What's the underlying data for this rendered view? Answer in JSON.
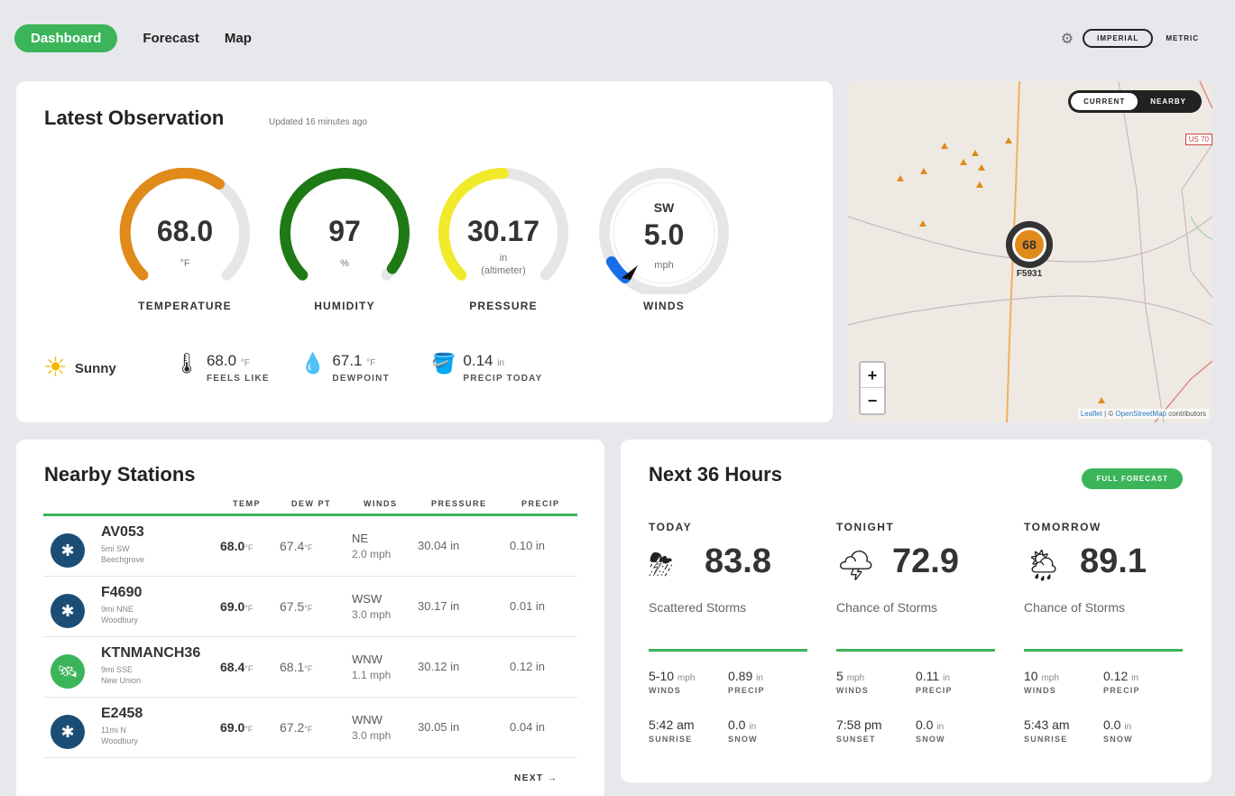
{
  "nav": {
    "dashboard": "Dashboard",
    "forecast": "Forecast",
    "map": "Map"
  },
  "units": {
    "imperial": "IMPERIAL",
    "metric": "METRIC"
  },
  "observation": {
    "title": "Latest Observation",
    "updated": "Updated 16 minutes ago",
    "gauges": [
      {
        "value": "68.0",
        "unit": "°F",
        "label": "TEMPERATURE",
        "color": "#e08a1a",
        "fill": 0.63
      },
      {
        "value": "97",
        "unit": "%",
        "label": "HUMIDITY",
        "color": "#1e7a14",
        "fill": 0.97
      },
      {
        "value": "30.17",
        "unit": "in",
        "unit2": "(altimeter)",
        "label": "PRESSURE",
        "color": "#f1ea2a",
        "fill": 0.5
      },
      {
        "dir": "SW",
        "value": "5.0",
        "unit": "mph",
        "label": "WINDS",
        "color": "#1a6de8"
      }
    ],
    "conditions": {
      "sky": "Sunny",
      "feels_like": {
        "value": "68.0",
        "unit": "°F",
        "label": "FEELS LIKE"
      },
      "dewpoint": {
        "value": "67.1",
        "unit": "°F",
        "label": "DEWPOINT"
      },
      "precip": {
        "value": "0.14",
        "unit": "in",
        "label": "PRECIP TODAY"
      }
    }
  },
  "map": {
    "toggle_current": "CURRENT",
    "toggle_nearby": "NEARBY",
    "marker_value": "68",
    "marker_label": "F5931",
    "road_label": "US 70",
    "zoom_in": "+",
    "zoom_out": "−",
    "attrib_leaflet": "Leaflet",
    "attrib_sep": " | © ",
    "attrib_osm": "OpenStreetMap",
    "attrib_rest": " contributors"
  },
  "nearby": {
    "title": "Nearby Stations",
    "headers": [
      "TEMP",
      "DEW PT",
      "WINDS",
      "PRESSURE",
      "PRECIP"
    ],
    "stations": [
      {
        "id": "AV053",
        "dist": "5mi SW",
        "place": "Beechgrove",
        "temp": "68.0",
        "dew": "67.4",
        "wdir": "NE",
        "wspd": "2.0 mph",
        "pres": "30.04 in",
        "prec": "0.10 in",
        "icon": "blue"
      },
      {
        "id": "F4690",
        "dist": "9mi NNE",
        "place": "Woodbury",
        "temp": "69.0",
        "dew": "67.5",
        "wdir": "WSW",
        "wspd": "3.0 mph",
        "pres": "30.17 in",
        "prec": "0.01 in",
        "icon": "blue"
      },
      {
        "id": "KTNMANCH36",
        "dist": "9mi SSE",
        "place": "New Union",
        "temp": "68.4",
        "dew": "68.1",
        "wdir": "WNW",
        "wspd": "1.1 mph",
        "pres": "30.12 in",
        "prec": "0.12 in",
        "icon": "green"
      },
      {
        "id": "E2458",
        "dist": "11mi N",
        "place": "Woodbury",
        "temp": "69.0",
        "dew": "67.2",
        "wdir": "WNW",
        "wspd": "3.0 mph",
        "pres": "30.05 in",
        "prec": "0.04 in",
        "icon": "blue"
      }
    ],
    "temp_unit": "°F",
    "next": "NEXT →"
  },
  "forecast": {
    "title": "Next 36 Hours",
    "full_button": "FULL FORECAST",
    "periods": [
      {
        "name": "TODAY",
        "temp": "83.8",
        "desc": "Scattered Storms",
        "icon": "storm-cloud-icon",
        "winds": "5-10",
        "winds_unit": "mph",
        "precip": "0.89",
        "precip_unit": "in",
        "sun": "5:42 am",
        "sun_label": "SUNRISE",
        "snow": "0.0",
        "snow_unit": "in"
      },
      {
        "name": "TONIGHT",
        "temp": "72.9",
        "desc": "Chance of Storms",
        "icon": "night-storm-icon",
        "winds": "5",
        "winds_unit": "mph",
        "precip": "0.11",
        "precip_unit": "in",
        "sun": "7:58 pm",
        "sun_label": "SUNSET",
        "snow": "0.0",
        "snow_unit": "in"
      },
      {
        "name": "TOMORROW",
        "temp": "89.1",
        "desc": "Chance of Storms",
        "icon": "sun-storm-icon",
        "winds": "10",
        "winds_unit": "mph",
        "precip": "0.12",
        "precip_unit": "in",
        "sun": "5:43 am",
        "sun_label": "SUNRISE",
        "snow": "0.0",
        "snow_unit": "in"
      }
    ],
    "labels": {
      "winds": "WINDS",
      "precip": "PRECIP",
      "snow": "SNOW"
    }
  }
}
